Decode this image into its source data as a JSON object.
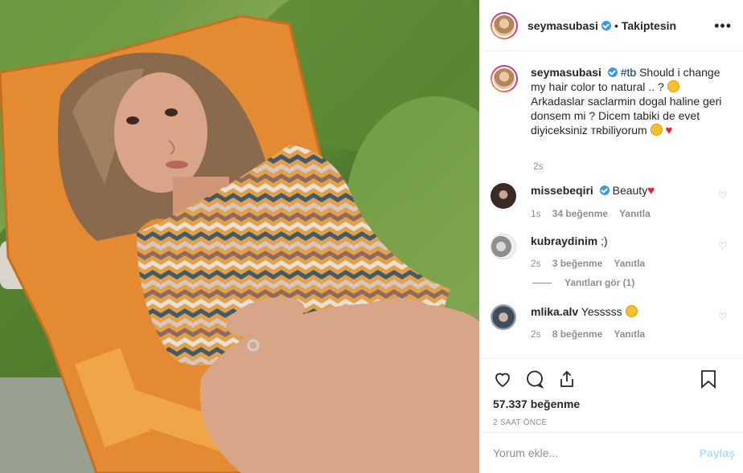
{
  "header": {
    "username": "seymasubasi",
    "separator": "•",
    "follow_status": "Takiptesin",
    "more_icon": "more-icon"
  },
  "caption": {
    "username": "seymasubasi",
    "hashtag": "#tb",
    "text": " Should i change my hair color to natural .. ? ",
    "text2": " Arkadaslar saclarmin dogal haline geri donsem mi ? Dicem tabiki de evet diyiceksiniz ᴛʀbiliyorum ",
    "time": "2s"
  },
  "comments": [
    {
      "username": "missebeqiri",
      "text": "Beauty",
      "time": "1s",
      "likes": "34 beğenme",
      "reply": "Yanıtla"
    },
    {
      "username": "kubraydinim",
      "text": ";)",
      "time": "2s",
      "likes": "3 beğenme",
      "reply": "Yanıtla",
      "view_replies": "Yanıtları gör (1)"
    },
    {
      "username": "mlika.alv",
      "text": "Yesssss",
      "time": "2s",
      "likes": "8 beğenme",
      "reply": "Yanıtla"
    }
  ],
  "actions": {
    "like_count": "57.337 beğenme",
    "time_ago": "2 SAAT ÖNCE"
  },
  "add_comment": {
    "placeholder": "Yorum ekle...",
    "post_label": "Paylaş"
  },
  "colors": {
    "verified": "#3897f0",
    "post_button": "#b2dffc",
    "hashtag": "#003569",
    "heart": "#ed1c3b"
  }
}
